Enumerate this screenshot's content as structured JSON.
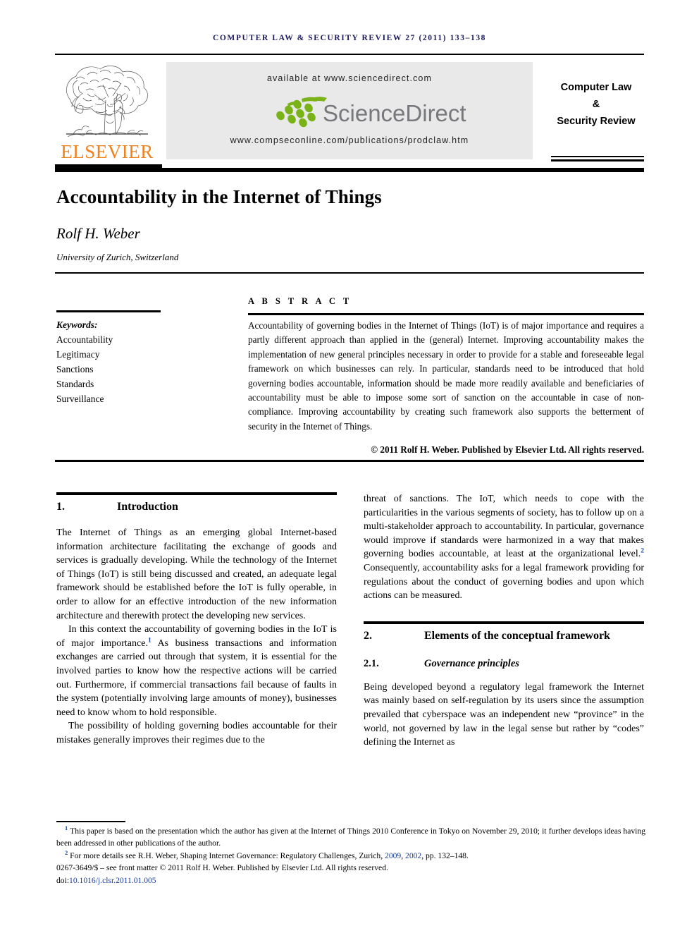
{
  "running_head": "Computer law & security review 27 (2011) 133–138",
  "masthead": {
    "publisher_name": "ELSEVIER",
    "publisher_logo_alt": "elsevier-tree-logo",
    "available_at": "available at www.sciencedirect.com",
    "sciencedirect_wordmark": "ScienceDirect",
    "journal_url": "www.compseconline.com/publications/prodclaw.htm",
    "journal_name_line1": "Computer Law",
    "journal_name_line2": "&",
    "journal_name_line3": "Security Review",
    "colors": {
      "elsevier_orange": "#f0821e",
      "panel_grey": "#e9e9e9",
      "sciencedirect_green": "#7ab317",
      "sciencedirect_grey": "#76787b",
      "running_head_navy": "#1a1a5e",
      "link_blue": "#1b3f94"
    }
  },
  "title": "Accountability in the Internet of Things",
  "author": "Rolf H. Weber",
  "affiliation": "University of Zurich, Switzerland",
  "keywords": {
    "heading": "Keywords:",
    "items": [
      "Accountability",
      "Legitimacy",
      "Sanctions",
      "Standards",
      "Surveillance"
    ]
  },
  "abstract": {
    "heading": "A B S T R A C T",
    "text": "Accountability of governing bodies in the Internet of Things (IoT) is of major importance and requires a partly different approach than applied in the (general) Internet. Improving accountability makes the implementation of new general principles necessary in order to provide for a stable and foreseeable legal framework on which businesses can rely. In particular, standards need to be introduced that hold governing bodies accountable, information should be made more readily available and beneficiaries of accountability must be able to impose some sort of sanction on the accountable in case of non-compliance. Improving accountability by creating such framework also supports the betterment of security in the Internet of Things.",
    "copyright": "© 2011 Rolf H. Weber. Published by Elsevier Ltd. All rights reserved."
  },
  "sections": {
    "intro": {
      "number": "1.",
      "title": "Introduction",
      "paragraphs": [
        "The Internet of Things as an emerging global Internet-based information architecture facilitating the exchange of goods and services is gradually developing. While the technology of the Internet of Things (IoT) is still being discussed and created, an adequate legal framework should be established before the IoT is fully operable, in order to allow for an effective introduction of the new information architecture and therewith protect the developing new services.",
        "In this context the accountability of governing bodies in the IoT is of major importance.",
        " As business transactions and information exchanges are carried out through that system, it is essential for the involved parties to know how the respective actions will be carried out. Furthermore, if commercial transactions fail because of faults in the system (potentially involving large amounts of money), businesses need to know whom to hold responsible.",
        "The possibility of holding governing bodies accountable for their mistakes generally improves their regimes due to the",
        "threat of sanctions. The IoT, which needs to cope with the particularities in the various segments of society, has to follow up on a multi-stakeholder approach to accountability. In particular, governance would improve if standards were harmonized in a way that makes governing bodies accountable, at least at the organizational level.",
        " Consequently, accountability asks for a legal framework providing for regulations about the conduct of governing bodies and upon which actions can be measured."
      ],
      "footnote_mark_1": "1",
      "footnote_mark_2": "2"
    },
    "framework": {
      "number": "2.",
      "title": "Elements of the conceptual framework",
      "sub_number": "2.1.",
      "sub_title": "Governance principles",
      "paragraph": "Being developed beyond a regulatory legal framework the Internet was mainly based on self-regulation by its users since the assumption prevailed that cyberspace was an independent new “province” in the world, not governed by law in the legal sense but rather by “codes” defining the Internet as"
    }
  },
  "footnotes": {
    "mark1": "1",
    "note1": "This paper is based on the presentation which the author has given at the Internet of Things 2010 Conference in Tokyo on November 29, 2010; it further develops ideas having been addressed in other publications of the author.",
    "mark2": "2",
    "note2_a": "For more details see R.H. Weber, Shaping Internet Governance: Regulatory Challenges, Zurich, ",
    "note2_link1": "2009",
    "note2_sep": ", ",
    "note2_link2": "2002",
    "note2_b": ", pp. 132–148.",
    "front_matter": "0267-3649/$ – see front matter © 2011 Rolf H. Weber. Published by Elsevier Ltd. All rights reserved.",
    "doi_label": "doi:",
    "doi_value": "10.1016/j.clsr.2011.01.005"
  }
}
